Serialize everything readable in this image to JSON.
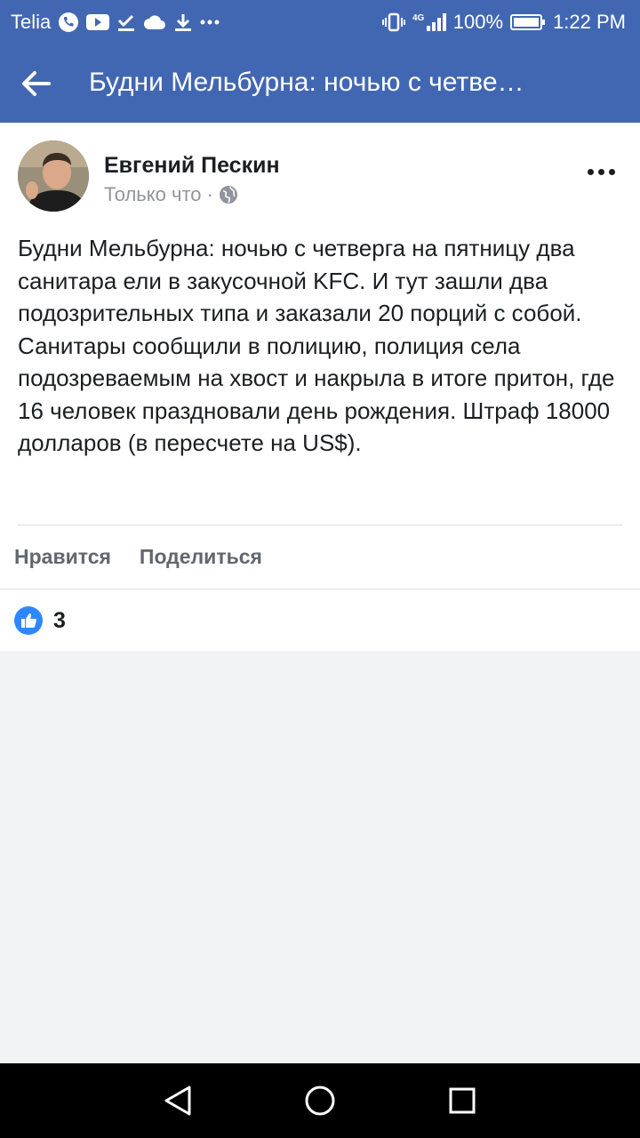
{
  "status_bar": {
    "carrier": "Telia",
    "battery": "100%",
    "time": "1:22 PM",
    "network": "4G",
    "left_icons": [
      "phone-icon",
      "youtube-icon",
      "check-icon",
      "cloud-icon",
      "download-icon",
      "more-notifications-icon"
    ],
    "right_icons": [
      "vibrate-icon",
      "signal-icon",
      "battery-icon"
    ]
  },
  "header": {
    "title": "Будни Мельбурна: ночью с четве…",
    "back_icon": "arrow-left-icon",
    "color": "#4267b2"
  },
  "post": {
    "author": "Евгений Пескин",
    "timestamp": "Только что",
    "separator": "·",
    "privacy_icon": "globe-icon",
    "text": "Будни Мельбурна: ночью с четверга на пятницу два санитара ели в закусочной KFC. И тут зашли два подозрительных типа и заказали 20 порций с собой. Санитары сообщили в полицию, полиция села подозреваемым на хвост и накрыла в итоге притон, где 16 человек праздновали день рождения. Штраф 18000 долларов (в пересчете на US$).",
    "actions": {
      "like": "Нравится",
      "share": "Поделиться"
    },
    "reactions": {
      "icon": "thumbs-up-icon",
      "count": "3"
    }
  },
  "nav_bar": {
    "icons": [
      "back-triangle-icon",
      "home-circle-icon",
      "recents-square-icon"
    ]
  }
}
